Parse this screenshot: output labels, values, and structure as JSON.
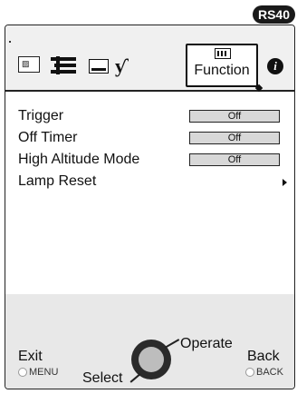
{
  "model_badge": "RS40",
  "tabs": [
    {
      "name": "picture",
      "icon": "picture-tab-icon"
    },
    {
      "name": "settings",
      "icon": "settings-tab-icon"
    },
    {
      "name": "screen",
      "icon": "screen-tab-icon"
    },
    {
      "name": "installation",
      "icon": "installation-tab-icon"
    },
    {
      "name": "function",
      "icon": "function-tab-icon",
      "label": "Function",
      "active": true
    },
    {
      "name": "information",
      "icon": "info-tab-icon",
      "glyph": "i"
    }
  ],
  "menu": {
    "items": [
      {
        "label": "Trigger",
        "value": "Off"
      },
      {
        "label": "Off Timer",
        "value": "Off"
      },
      {
        "label": "High Altitude Mode",
        "value": "Off"
      },
      {
        "label": "Lamp Reset",
        "value": ""
      }
    ]
  },
  "footer": {
    "exit_label": "Exit",
    "exit_key": "MENU",
    "select_label": "Select",
    "operate_label": "Operate",
    "back_label": "Back",
    "back_key": "BACK"
  }
}
